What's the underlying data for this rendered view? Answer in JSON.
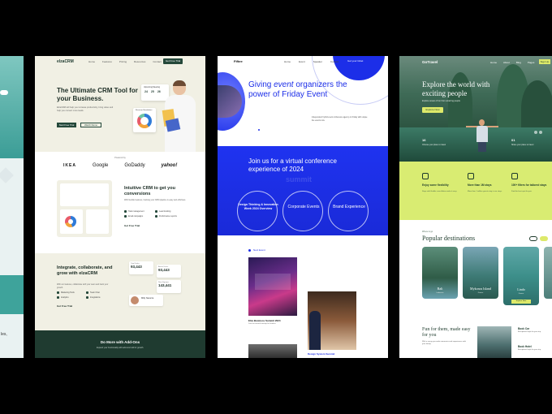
{
  "panel0": {
    "text": "les,"
  },
  "crm": {
    "logo": "elzaCRM",
    "nav": [
      "Home",
      "Features",
      "Pricing",
      "Resources",
      "Contact"
    ],
    "nav_button": "Get Free Trial",
    "hero_title": "The Ultimate CRM Tool for your Business.",
    "hero_sub": "ElzaCRM will help you increase productivity, bring value and help you convert more leads.",
    "primary_button": "Start Free Trial",
    "secondary_button": "Watch Demo",
    "calendar_title": "Upcoming Meeting",
    "calendar_days": [
      "24",
      "25",
      "26"
    ],
    "chart_card_title": "Revenue Breakdown",
    "powered_by": "Powered by",
    "logos": [
      "IKEA",
      "Google",
      "GoDaddy",
      "yahoo!"
    ],
    "section2_title": "Intuitive CRM to get you conversions",
    "section2_sub": "With flexible features, tracking your CRM pipeline is easy and effortless.",
    "section2_features": [
      "Task management",
      "Lead tracking",
      "Email campaigns",
      "Performance reports"
    ],
    "section2_link": "Get Free Trial",
    "section3_title": "Integrate, collaborate, and grow with elzaCRM",
    "section3_sub": "With our features, collaborate with your team and track your growth.",
    "section3_features": [
      "Marketing Tools",
      "Team Chat",
      "Analytics",
      "Integrations"
    ],
    "section3_link": "Get Free Trial",
    "stats": [
      {
        "label": "Total Sales",
        "value": "93,443"
      },
      {
        "label": "Active Users",
        "value": "93,443"
      },
      {
        "label": "New Signups",
        "value": "143,441"
      }
    ],
    "avatar_name": "Milly Navarra",
    "footer_title": "Do More with Add-Ons",
    "footer_sub": "Expand your functionality with add-ons built for growth."
  },
  "event": {
    "logo": "Fiftee",
    "nav": [
      "Home",
      "Event",
      "Speaker",
      "Contact"
    ],
    "nav_button": "Get your ticket",
    "hero_title_pre": "Giving ",
    "hero_title_em": "event",
    "hero_title_post": " organizers the power of Friday Event",
    "hero_sub": "Independent hybrid event conference agency on Friday with unique live events now.",
    "band_title": "Join us for a virtual conference experience of 2024",
    "band_ghost": "summit",
    "circles": [
      "Design Thinking & Innovation Week 2024 Overview",
      "Corporate Events",
      "Brand Experience"
    ],
    "section_label": "Next Event",
    "card1_title": "Elza Business Summit 2024",
    "card1_sub": "Join the annual meetup for leaders",
    "card2_title": "Design System Summit"
  },
  "travel": {
    "logo": "GoTravel",
    "nav": [
      "Home",
      "About",
      "Blog",
      "Pages",
      "Contact"
    ],
    "nav_button": "Sign Up",
    "hero_title": "Explore the world with exciting people",
    "hero_sub": "Explore ocean of fun from amazing people",
    "hero_button": "Explore Now",
    "stats": [
      {
        "value": "16",
        "label": "Choose your place to travel"
      },
      {
        "value": "01",
        "label": "Share your place to travel"
      }
    ],
    "features": [
      {
        "title": "Enjoy some flexibility",
        "sub": "Stays with flexible cancellation make it easy."
      },
      {
        "title": "More than 1M stays",
        "sub": "More than 1 million guests stay in our stays."
      },
      {
        "title": "100+ filters for tailored stays",
        "sub": "Find the best spot for you."
      }
    ],
    "section_label": "Where to go",
    "section_title": "Popular destinations",
    "destinations": [
      {
        "name": "Bali",
        "sub": "Indonesia"
      },
      {
        "name": "Mykonos Island",
        "sub": "Greece"
      },
      {
        "name": "Lindo",
        "sub": "Greece",
        "button": "Explore Now"
      }
    ],
    "fun_title": "Fun for them, made easy for you",
    "fun_sub": "With a vacay you make memories and experiences with your family.",
    "side_items": [
      {
        "title": "Book Car",
        "sub": "Exceptional style for your trip"
      },
      {
        "title": "Book Hotel",
        "sub": "Exceptional style for your trip"
      }
    ]
  }
}
